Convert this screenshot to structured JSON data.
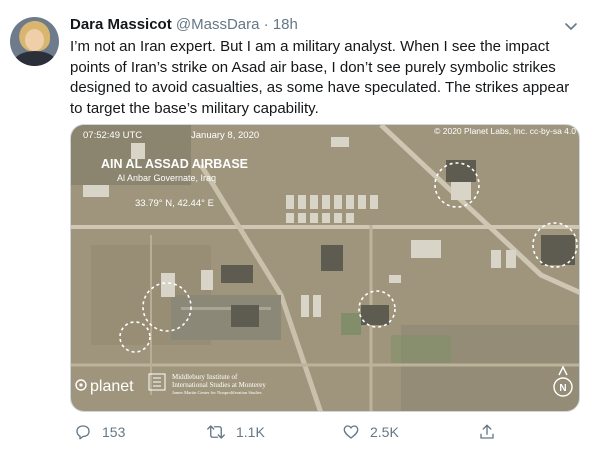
{
  "tweet": {
    "author_name": "Dara Massicot",
    "author_handle": "@MassDara",
    "separator": "·",
    "time": "18h",
    "text": "I’m not an Iran expert. But I am a military analyst. When I see the impact points of Iran’s strike on Asad air base, I don’t see purely symbolic strikes designed to avoid casualties, as some have speculated. The strikes appear to target the base’s military capability."
  },
  "media": {
    "timestamp": "07:52:49 UTC",
    "date": "January 8, 2020",
    "copyright": "© 2020 Planet Labs, Inc. cc-by-sa 4.0",
    "base_name": "AIN AL ASSAD AIRBASE",
    "location": "Al Anbar Governate, Iraq",
    "coordinates": "33.79° N, 42.44° E",
    "logo_text": "planet",
    "institute_line1": "Middlebury Institute of",
    "institute_line2": "International Studies at Monterey",
    "institute_line3": "James Martin Center for Nonproliferation Studies",
    "north_label": "N"
  },
  "actions": {
    "replies": "153",
    "retweets": "1.1K",
    "likes": "2.5K"
  },
  "colors": {
    "text": "#14171a",
    "secondary": "#657786",
    "border": "#ccd6dd",
    "terrain": "#a59a80"
  }
}
